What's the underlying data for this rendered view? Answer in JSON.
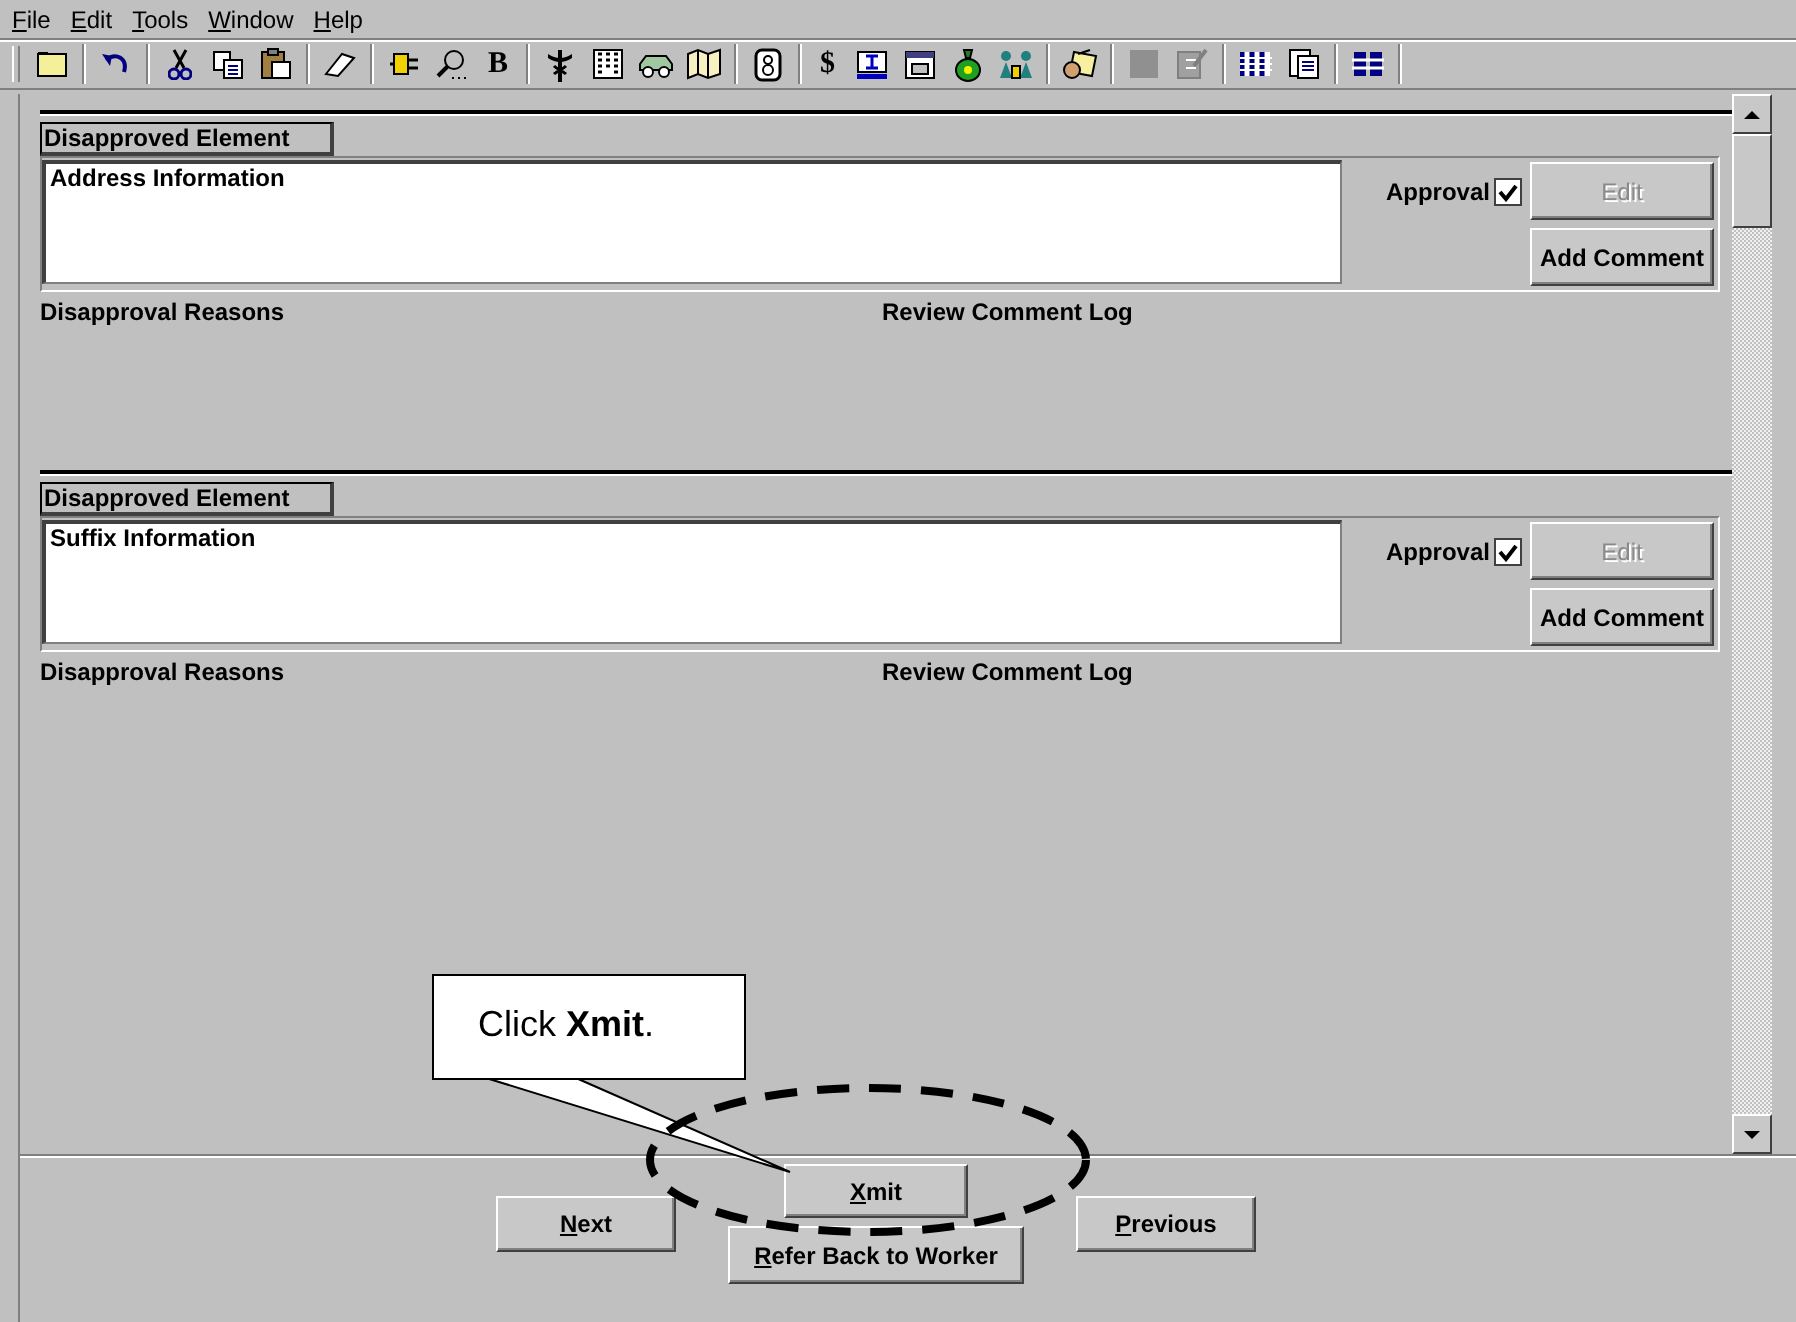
{
  "menu": [
    {
      "label": "File"
    },
    {
      "label": "Edit"
    },
    {
      "label": "Tools"
    },
    {
      "label": "Window"
    },
    {
      "label": "Help"
    }
  ],
  "toolbar": [
    {
      "kind": "bold",
      "label": "B"
    },
    {
      "kind": "dollar",
      "label": "$"
    }
  ],
  "sections": [
    {
      "label": "Disapproved Element",
      "value": "Address Information",
      "approval_label": "Approval",
      "approved": true,
      "edit": {
        "label": "Edit",
        "disabled": true
      },
      "add_comment": "Add Comment",
      "reasons_label": "Disapproval Reasons",
      "log_label": "Review Comment Log"
    },
    {
      "label": "Disapproved Element",
      "value": "Suffix Information",
      "approval_label": "Approval",
      "approved": true,
      "edit": {
        "label": "Edit",
        "disabled": true
      },
      "add_comment": "Add Comment",
      "reasons_label": "Disapproval Reasons",
      "log_label": "Review Comment Log"
    }
  ],
  "buttons": {
    "next": "Next",
    "xmit": "Xmit",
    "refer": "Refer Back to Worker",
    "previous": "Previous"
  },
  "callout": {
    "text": "Click **Xmit**."
  }
}
